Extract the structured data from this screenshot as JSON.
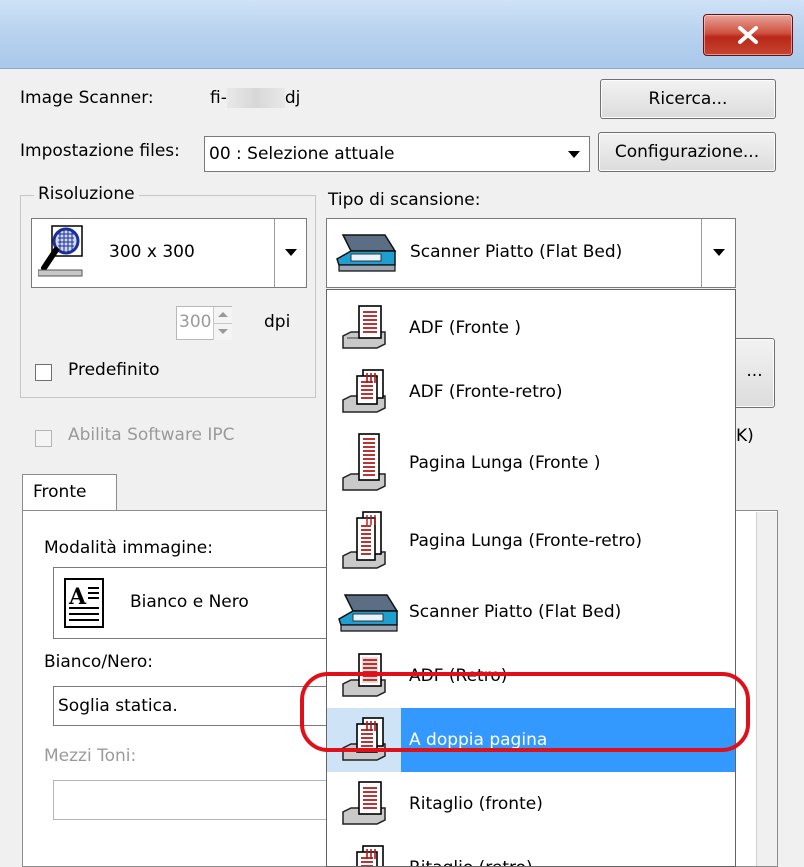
{
  "window": {
    "close_label": "x"
  },
  "scanner": {
    "label": "Image Scanner:",
    "value_prefix": "fi-",
    "value_suffix": "dj",
    "search_button": "Ricerca..."
  },
  "files": {
    "label": "Impostazione files:",
    "value": "00 : Selezione attuale",
    "config_button": "Configurazione..."
  },
  "resolution": {
    "group_label": "Risoluzione",
    "value": "300 x 300",
    "dpi_value": "300",
    "dpi_unit": "dpi",
    "default_label": "Predefinito"
  },
  "scan_type": {
    "label": "Tipo di scansione:",
    "value": "Scanner Piatto (Flat Bed)"
  },
  "ipc": {
    "label": "Abilita Software IPC"
  },
  "side_fragments": {
    "button": "...",
    "text": "K)"
  },
  "tabs": {
    "front": "Fronte"
  },
  "image_mode": {
    "label": "Modalità immagine:",
    "value": "Bianco e Nero"
  },
  "bw": {
    "label": "Bianco/Nero:",
    "value": "Soglia statica."
  },
  "halftone": {
    "label": "Mezzi Toni:",
    "value": ""
  },
  "dropdown": {
    "items": [
      {
        "label": "ADF (Fronte )",
        "icon": "adf-front-icon"
      },
      {
        "label": "ADF (Fronte-retro)",
        "icon": "adf-duplex-icon"
      },
      {
        "label": "Pagina Lunga (Fronte )",
        "icon": "long-page-front-icon"
      },
      {
        "label": "Pagina Lunga (Fronte-retro)",
        "icon": "long-page-duplex-icon"
      },
      {
        "label": "Scanner Piatto (Flat Bed)",
        "icon": "flatbed-icon"
      },
      {
        "label": "ADF (Retro)",
        "icon": "adf-back-icon"
      },
      {
        "label": "A doppia pagina",
        "icon": "double-page-icon",
        "selected": true
      },
      {
        "label": "Ritaglio (fronte)",
        "icon": "crop-front-icon"
      },
      {
        "label": "Ritaglio (retro)",
        "icon": "crop-back-icon"
      }
    ]
  },
  "colors": {
    "selection": "#3399ff",
    "highlight_ring": "#e0101a",
    "close_button": "#c5442f"
  }
}
